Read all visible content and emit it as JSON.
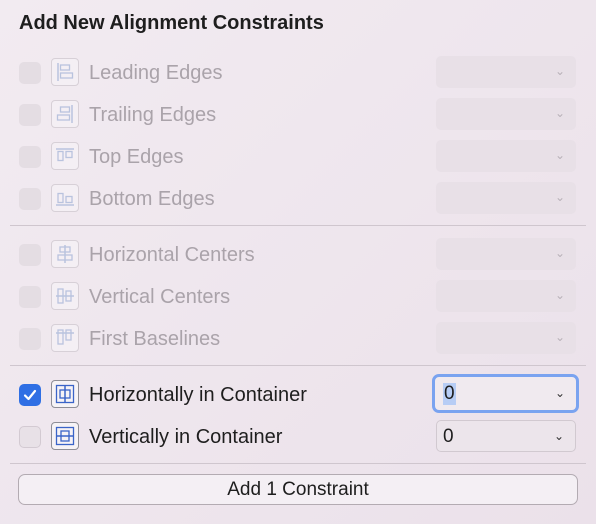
{
  "title": "Add New Alignment Constraints",
  "rows": [
    {
      "label": "Leading Edges",
      "icon": "leading-edges-icon",
      "enabled": false,
      "checked": false,
      "value": ""
    },
    {
      "label": "Trailing Edges",
      "icon": "trailing-edges-icon",
      "enabled": false,
      "checked": false,
      "value": ""
    },
    {
      "label": "Top Edges",
      "icon": "top-edges-icon",
      "enabled": false,
      "checked": false,
      "value": ""
    },
    {
      "label": "Bottom Edges",
      "icon": "bottom-edges-icon",
      "enabled": false,
      "checked": false,
      "value": ""
    },
    {
      "label": "Horizontal Centers",
      "icon": "horizontal-centers-icon",
      "enabled": false,
      "checked": false,
      "value": ""
    },
    {
      "label": "Vertical Centers",
      "icon": "vertical-centers-icon",
      "enabled": false,
      "checked": false,
      "value": ""
    },
    {
      "label": "First Baselines",
      "icon": "first-baselines-icon",
      "enabled": false,
      "checked": false,
      "value": ""
    },
    {
      "label": "Horizontally in Container",
      "icon": "horizontally-in-container-icon",
      "enabled": true,
      "checked": true,
      "value": "0"
    },
    {
      "label": "Vertically in Container",
      "icon": "vertically-in-container-icon",
      "enabled": true,
      "checked": false,
      "value": "0"
    }
  ],
  "add_button_label": "Add 1 Constraint",
  "colors": {
    "accent": "#2f6fe4",
    "focus_ring": "#7aa3f0",
    "disabled_text": "#aaa3aa"
  }
}
